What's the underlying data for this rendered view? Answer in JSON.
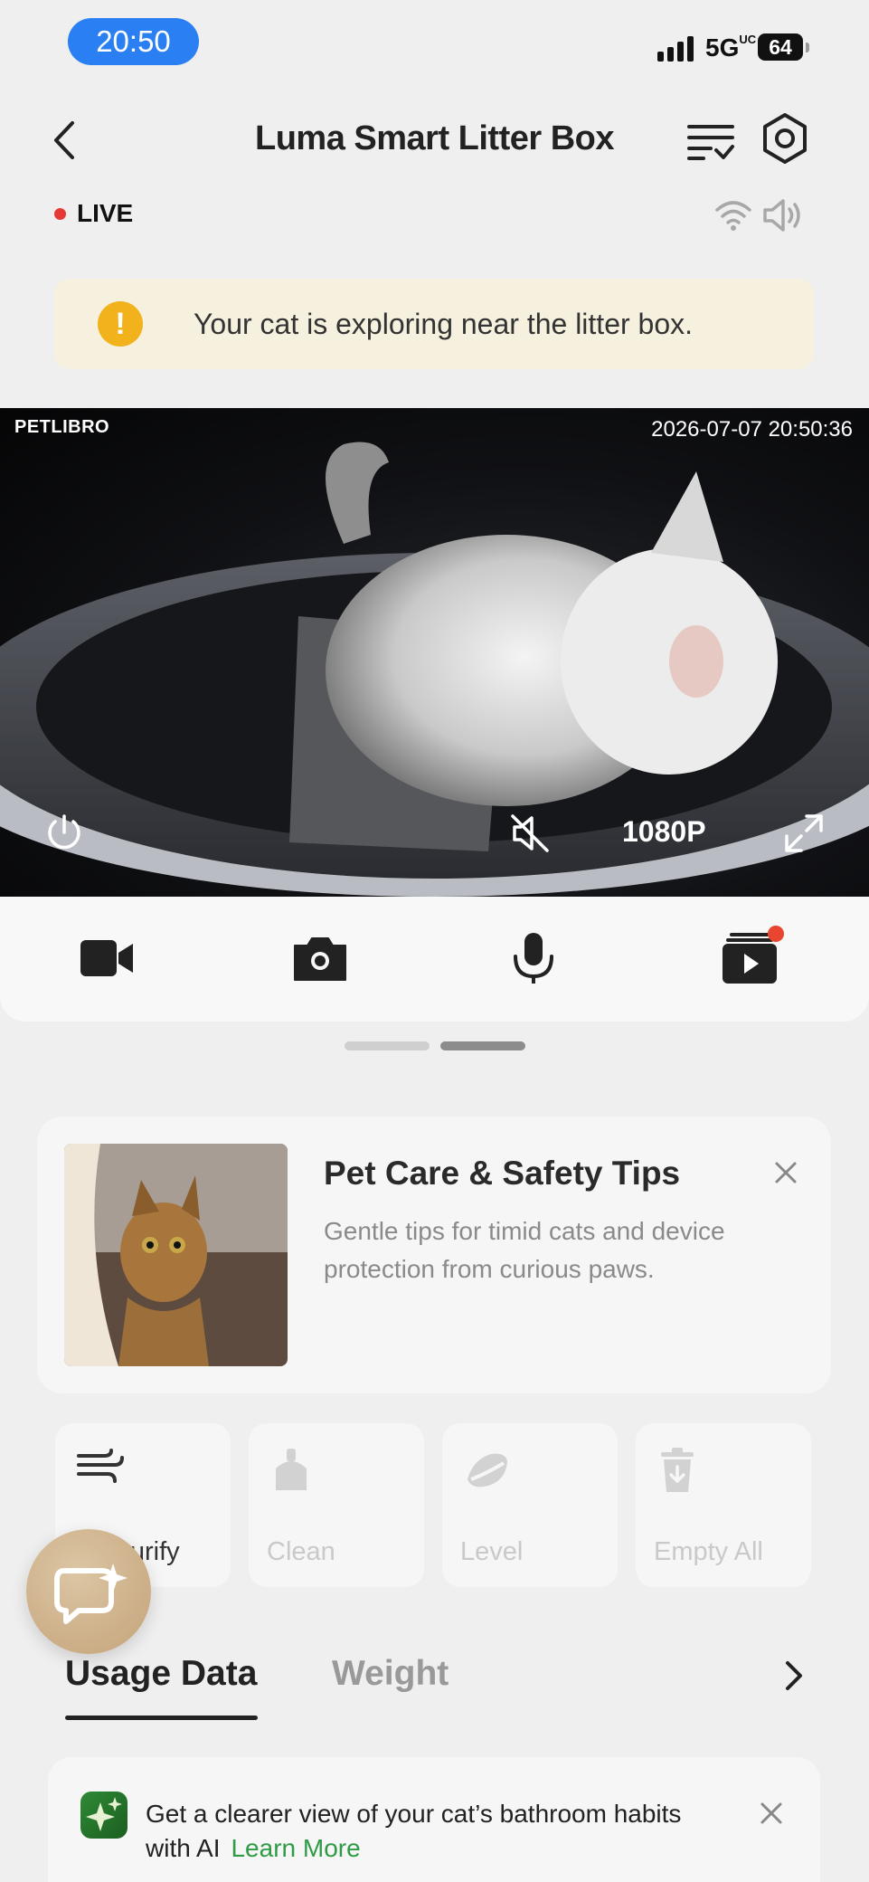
{
  "status_bar": {
    "time": "20:50",
    "network": "5G",
    "network_sup": "UC",
    "battery": "64"
  },
  "header": {
    "title": "Luma Smart Litter Box"
  },
  "live": {
    "label": "LIVE",
    "color": "#e53935"
  },
  "alert": {
    "icon_glyph": "!",
    "message": "Your cat is exploring near the litter box."
  },
  "video": {
    "brand": "PETLIBRO",
    "timestamp": "2026-07-07 20:50:36",
    "resolution": "1080P"
  },
  "controls": {
    "icons": [
      "video-record-icon",
      "camera-icon",
      "microphone-icon",
      "playback-icon"
    ],
    "notification_color": "#e8462e"
  },
  "pager": {
    "pages": 2,
    "active": 1
  },
  "tips_card": {
    "title": "Pet Care & Safety Tips",
    "description": "Gentle tips for timid cats and device protection from curious paws."
  },
  "actions": [
    {
      "label": "Air Purify",
      "enabled": true
    },
    {
      "label": "Clean",
      "enabled": false
    },
    {
      "label": "Level",
      "enabled": false
    },
    {
      "label": "Empty All",
      "enabled": false
    }
  ],
  "tabs": {
    "usage": "Usage Data",
    "weight": "Weight"
  },
  "ai_banner": {
    "message": "Get a clearer view of your cat’s bathroom habits with AI",
    "link": "Learn More",
    "accent": "#2e9b45"
  }
}
